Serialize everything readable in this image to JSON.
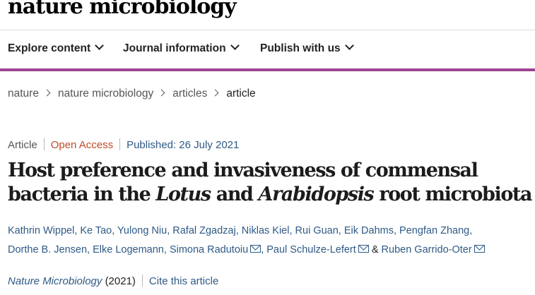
{
  "brand": "nature microbiology",
  "nav": {
    "explore": "Explore content",
    "journal_info": "Journal information",
    "publish": "Publish with us"
  },
  "breadcrumb": [
    "nature",
    "nature microbiology",
    "articles",
    "article"
  ],
  "meta": {
    "type": "Article",
    "access": "Open Access",
    "published": "Published: 26 July 2021"
  },
  "title": {
    "line1": "Host preference and invasiveness of commensal",
    "line2_pre": "bacteria in the ",
    "line2_italic1": "Lotus",
    "line2_mid": " and ",
    "line2_italic2": "Arabidopsis",
    "line2_post": " root microbiota"
  },
  "authors": [
    "Kathrin Wippel",
    "Ke Tao",
    "Yulong Niu",
    "Rafal Zgadzaj",
    "Niklas Kiel",
    "Rui Guan",
    "Eik Dahms",
    "Pengfan Zhang",
    "Dorthe B. Jensen",
    "Elke Logemann",
    "Simona Radutoiu",
    "Paul Schulze-Lefert",
    "Ruben Garrido-Oter"
  ],
  "authors_amp": "&",
  "citation": {
    "journal": "Nature Microbiology",
    "year": "(2021)",
    "cite_label": "Cite this article"
  },
  "colors": {
    "accent_bar": "#9d448f",
    "link": "#2e5a86",
    "open_access": "#c04b24"
  }
}
